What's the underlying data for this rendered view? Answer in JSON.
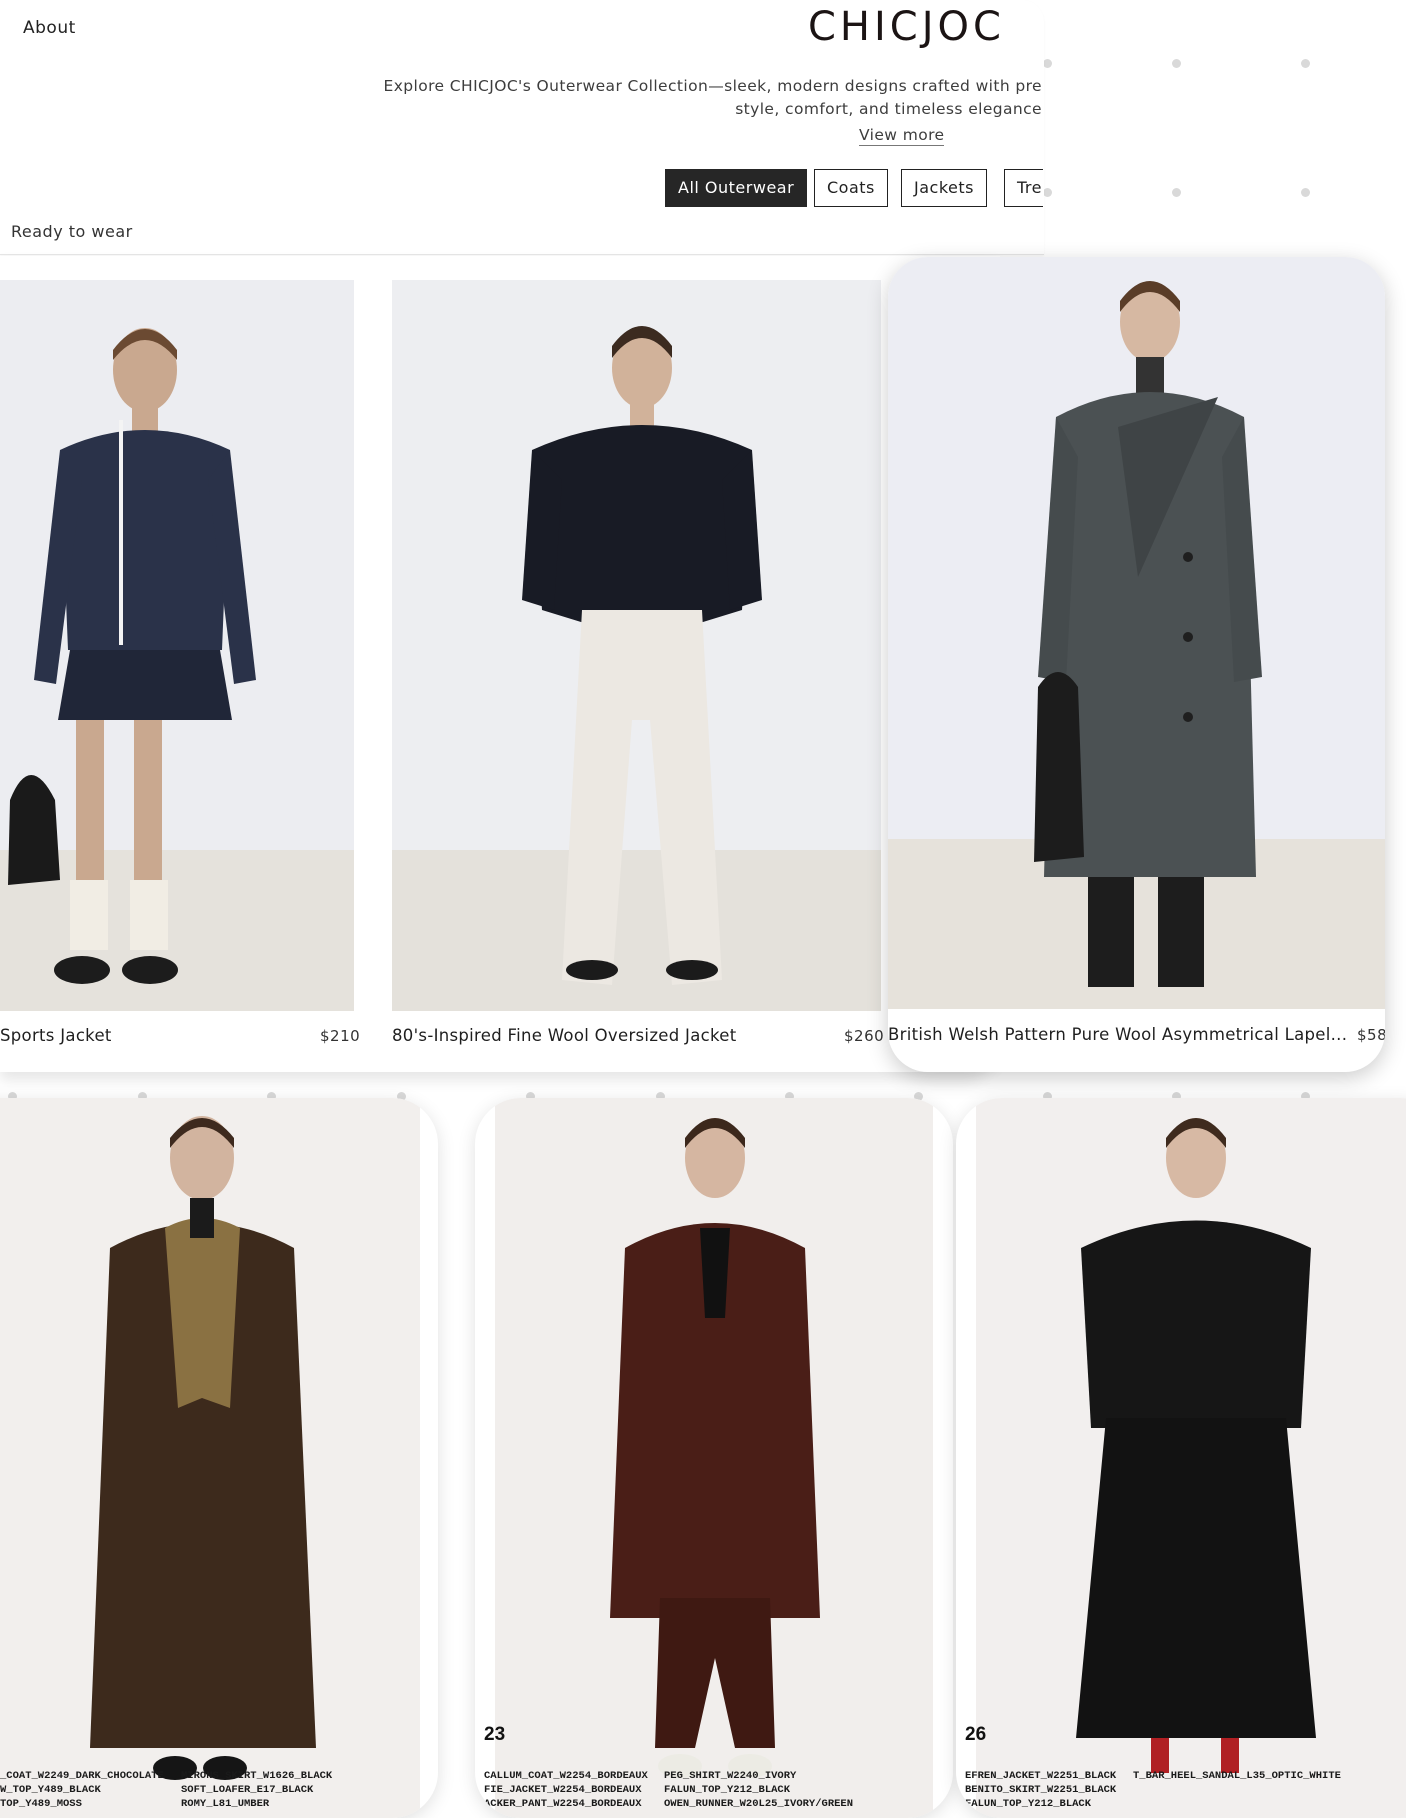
{
  "header": {
    "about_label": "About",
    "brand": "CHICJOC",
    "intro_line1": "Explore CHICJOC's Outerwear Collection—sleek, modern designs crafted with pre",
    "intro_line2": "style, comfort, and timeless elegance",
    "view_more": "View more"
  },
  "filters": [
    {
      "label": "All Outerwear",
      "active": true
    },
    {
      "label": "Coats",
      "active": false
    },
    {
      "label": "Jackets",
      "active": false
    },
    {
      "label": "Tre",
      "active": false
    }
  ],
  "section_label": "Ready to wear",
  "products": [
    {
      "title": "Sports Jacket",
      "price": "$210"
    },
    {
      "title": "80's-Inspired Fine Wool Oversized Jacket",
      "price": "$260"
    },
    {
      "title": "British Welsh Pattern Pure Wool Asymmetrical Lapel...",
      "price": "$58"
    }
  ],
  "looks": [
    {
      "number": "",
      "codes_col1": [
        "_COAT_W2249_DARK_CHOCOLATE",
        "W_TOP_Y489_BLACK",
        "TOP_Y489_MOSS"
      ],
      "codes_col2": [
        "MIRONS_SKIRT_W1626_BLACK",
        "SOFT_LOAFER_E17_BLACK",
        "ROMY_L81_UMBER"
      ]
    },
    {
      "number": "23",
      "codes_col1": [
        "CALLUM_COAT_W2254_BORDEAUX",
        "FIE_JACKET_W2254_BORDEAUX",
        "ACKER_PANT_W2254_BORDEAUX"
      ],
      "codes_col2": [
        "PEG_SHIRT_W2240_IVORY",
        "FALUN_TOP_Y212_BLACK",
        "OWEN_RUNNER_W20L25_IVORY/GREEN"
      ]
    },
    {
      "number": "26",
      "codes_col1": [
        "EFREN_JACKET_W2251_BLACK",
        "BENITO_SKIRT_W2251_BLACK",
        "FALUN_TOP_Y212_BLACK"
      ],
      "codes_col2": [
        "T_BAR_HEEL_SANDAL_L35_OPTIC_WHITE"
      ]
    }
  ],
  "colors": {
    "active_filter": "#262626",
    "background": "#ffffff",
    "dot": "#d9d9d9"
  }
}
